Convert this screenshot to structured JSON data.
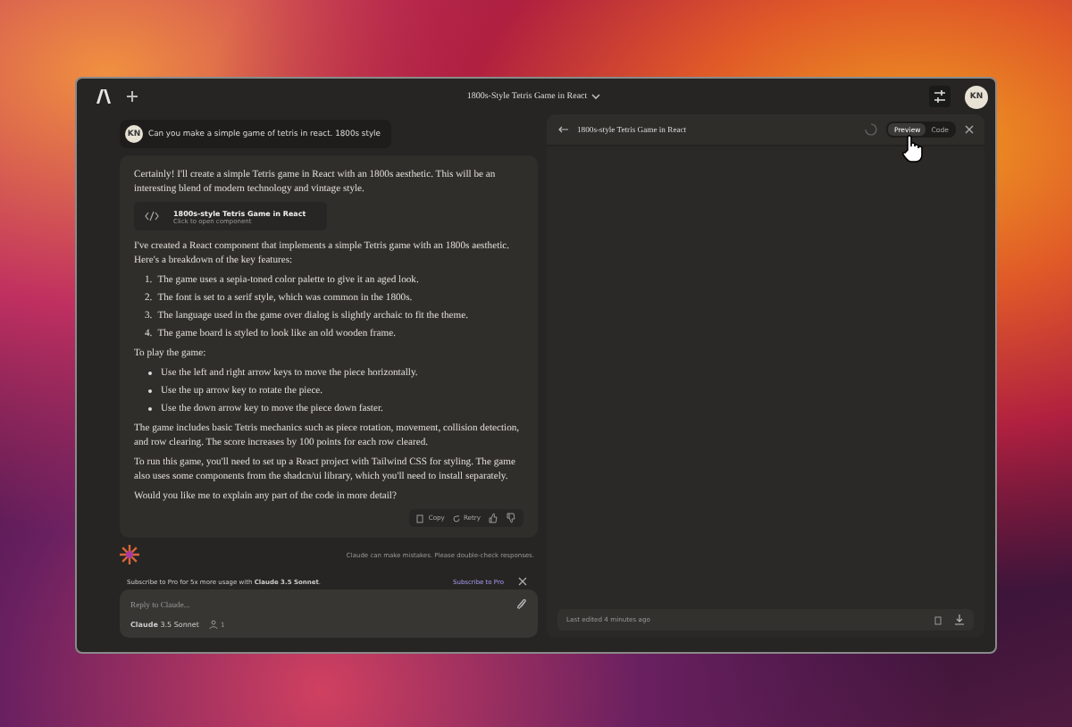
{
  "window": {
    "title": "1800s-Style Tetris Game in React",
    "avatar": "KN"
  },
  "user_message": {
    "avatar": "KN",
    "text": "Can you make a simple game of tetris in react. 1800s style"
  },
  "assistant": {
    "blocks": [
      {
        "kind": "paragraph",
        "text": "Certainly! I'll create a simple Tetris game in React with an 1800s aesthetic. This will be an interesting blend of modern technology and vintage style."
      },
      {
        "kind": "artifact",
        "title": "1800s-style Tetris Game in React",
        "subtitle": "Click to open component"
      },
      {
        "kind": "paragraph",
        "text": "I've created a React component that implements a simple Tetris game with an 1800s aesthetic. Here's a breakdown of the key features:"
      },
      {
        "kind": "numbered",
        "items": [
          {
            "number": "1.",
            "text": "The game uses a sepia-toned color palette to give it an aged look."
          },
          {
            "number": "2.",
            "text": "The font is set to a serif style, which was common in the 1800s."
          },
          {
            "number": "3.",
            "text": "The language used in the game over dialog is slightly archaic to fit the theme."
          },
          {
            "number": "4.",
            "text": "The game board is styled to look like an old wooden frame."
          }
        ]
      },
      {
        "kind": "paragraph",
        "text": "To play the game:"
      },
      {
        "kind": "bulleted",
        "items": [
          {
            "text": "Use the left and right arrow keys to move the piece horizontally."
          },
          {
            "text": "Use the up arrow key to rotate the piece."
          },
          {
            "text": "Use the down arrow key to move the piece down faster."
          }
        ]
      },
      {
        "kind": "paragraph",
        "text": "The game includes basic Tetris mechanics such as piece rotation, movement, collision detection, and row clearing. The score increases by 100 points for each row cleared."
      },
      {
        "kind": "paragraph",
        "text": "To run this game, you'll need to set up a React project with Tailwind CSS for styling. The game also uses some components from the shadcn/ui library, which you'll need to install separately."
      },
      {
        "kind": "paragraph",
        "text": "Would you like me to explain any part of the code in more detail?"
      }
    ],
    "actions": [
      {
        "kind": "copy",
        "label": "Copy"
      },
      {
        "kind": "retry",
        "label": "Retry"
      },
      {
        "kind": "thumbs_up"
      },
      {
        "kind": "thumbs_down"
      }
    ],
    "disclaimer": "Claude can make mistakes. Please double-check responses."
  },
  "subscribe": {
    "text": "Subscribe to Pro for 5x more usage with **Claude 3.5 Sonnet**.",
    "link": "Subscribe to Pro"
  },
  "composer": {
    "placeholder": "Reply to Claude...",
    "model": "**Claude** 3.5 Sonnet",
    "count": "1"
  },
  "artifact_panel": {
    "title": "1800s-style Tetris Game in React",
    "loading": true,
    "tabs": [
      {
        "label": "Preview",
        "selected": true
      },
      {
        "label": "Code",
        "selected": false
      }
    ],
    "footer": "Last edited 4 minutes ago"
  }
}
